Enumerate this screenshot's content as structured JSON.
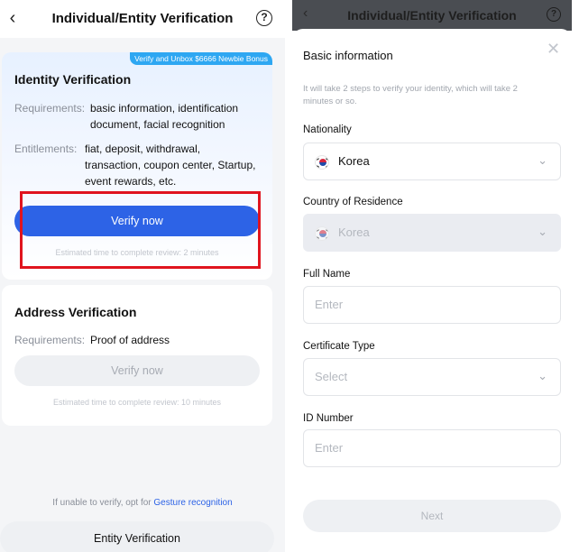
{
  "left": {
    "header": {
      "title": "Individual/Entity Verification",
      "back_icon": "chevron-left-icon",
      "help_icon": "question-circle-icon",
      "help_glyph": "?"
    },
    "identity_card": {
      "bonus_badge": "Verify and Unbox $6666 Newbie Bonus",
      "title": "Identity Verification",
      "requirements_label": "Requirements:",
      "requirements_line1": "basic information, identification",
      "requirements_line2": "document, facial recognition",
      "entitlements_label": "Entitlements:",
      "entitlements_line1": "fiat, deposit, withdrawal,",
      "entitlements_line2": "transaction, coupon center, Startup,",
      "entitlements_line3": "event rewards, etc.",
      "button_label": "Verify now",
      "estimate": "Estimated time to complete review: 2 minutes"
    },
    "address_card": {
      "title": "Address Verification",
      "requirements_label": "Requirements:",
      "requirements_value": "Proof of address",
      "button_label": "Verify now",
      "estimate": "Estimated time to complete review: 10 minutes"
    },
    "footer": {
      "gesture_prefix": "If unable to verify, opt for",
      "gesture_link": "Gesture recognition",
      "entity_button": "Entity Verification"
    }
  },
  "right": {
    "header": {
      "title": "Individual/Entity Verification",
      "back_icon": "chevron-left-icon",
      "help_icon": "question-circle-icon",
      "help_glyph": "?"
    },
    "sheet": {
      "title": "Basic information",
      "close_icon": "close-icon",
      "description": "It will take 2 steps to verify your identity, which will take 2 minutes or so.",
      "nationality_label": "Nationality",
      "nationality_value": "Korea",
      "residence_label": "Country of Residence",
      "residence_value": "Korea",
      "fullname_label": "Full Name",
      "fullname_placeholder": "Enter",
      "certificate_label": "Certificate Type",
      "certificate_placeholder": "Select",
      "id_label": "ID Number",
      "id_placeholder": "Enter",
      "next_button": "Next"
    }
  },
  "colors": {
    "primary": "#2d63e6",
    "highlight": "#e0141e",
    "badge": "#2ea7f2"
  }
}
